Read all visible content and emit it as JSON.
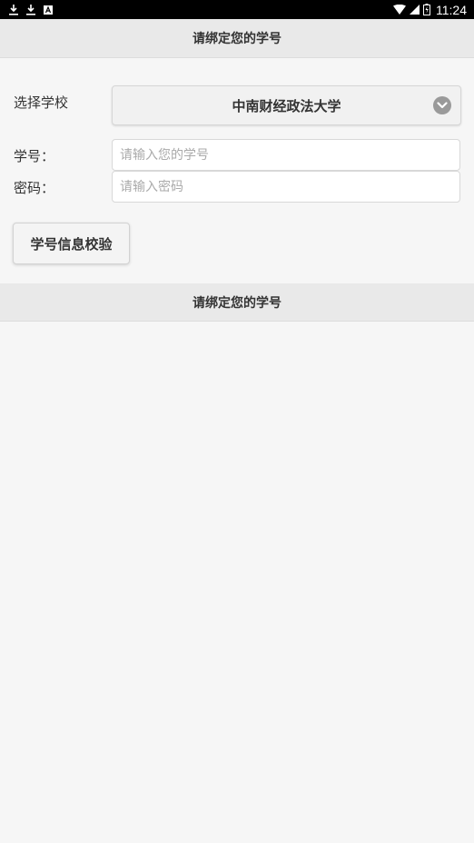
{
  "status_bar": {
    "time": "11:24",
    "left_icons": [
      "download-icon",
      "download-icon",
      "notification-a-icon"
    ],
    "right_icons": [
      "wifi-icon",
      "signal-icon",
      "battery-icon"
    ]
  },
  "header": {
    "title": "请绑定您的学号"
  },
  "form": {
    "school_label": "选择学校",
    "school_selected": "中南财经政法大学",
    "student_id_label": "学号：",
    "student_id_placeholder": "请输入您的学号",
    "student_id_value": "",
    "password_label": "密码：",
    "password_placeholder": "请输入密码",
    "password_value": "",
    "verify_button": "学号信息校验"
  },
  "section_header": {
    "title": "请绑定您的学号"
  },
  "colors": {
    "header_bg": "#e9e9e9",
    "page_bg": "#f6f6f6",
    "status_bar_bg": "#000000"
  }
}
